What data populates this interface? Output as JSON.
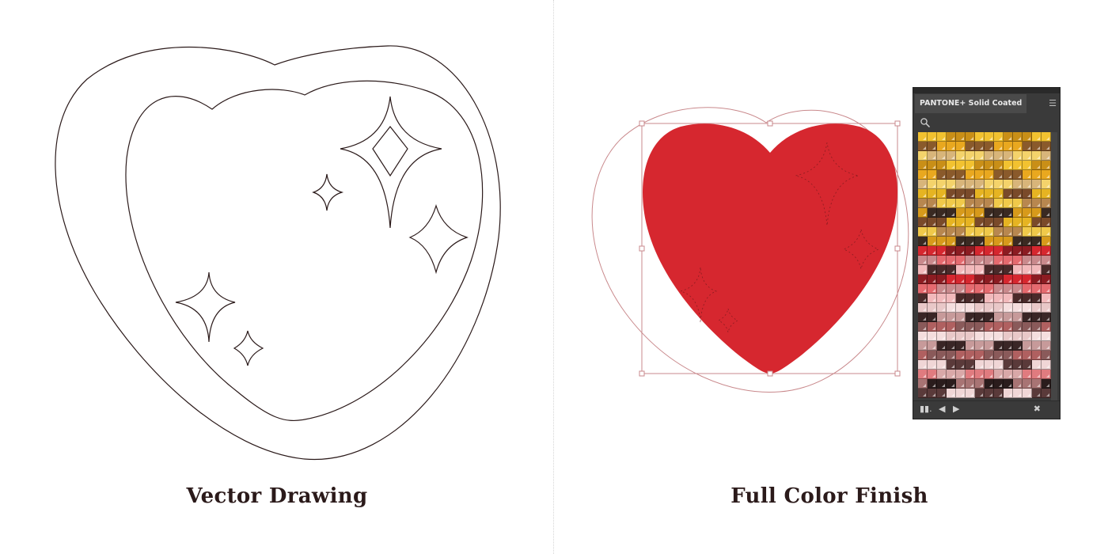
{
  "captions": {
    "left": "Vector Drawing",
    "right": "Full Color Finish"
  },
  "colors": {
    "outline": "#2b1a1a",
    "heart_fill": "#d6272f",
    "guide_stroke": "#c9898c",
    "panel_bg": "#3a3a3a"
  },
  "swatch_panel": {
    "title": "PANTONE+ Solid Coated",
    "menu_icon": "hamburger-icon",
    "search_icon": "magnifier-icon",
    "footer_icons": [
      "swatch-library-icon",
      "previous-icon",
      "next-icon",
      "close-icon"
    ]
  }
}
